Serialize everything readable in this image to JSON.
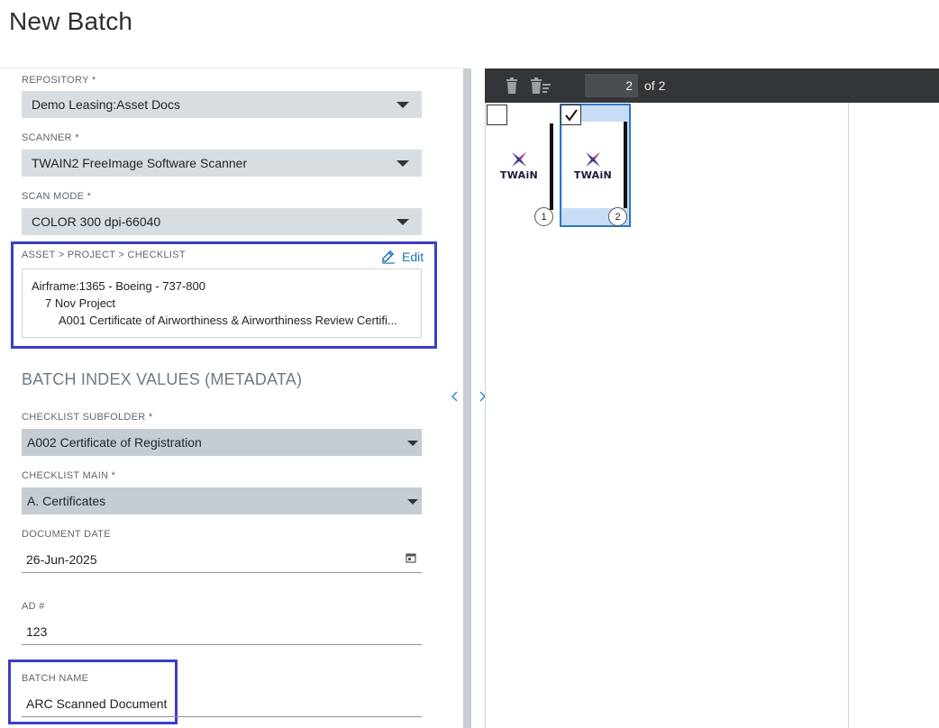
{
  "page": {
    "title": "New Batch"
  },
  "form": {
    "repository": {
      "label": "REPOSITORY *",
      "value": "Demo Leasing:Asset Docs"
    },
    "scanner": {
      "label": "SCANNER *",
      "value": "TWAIN2 FreeImage Software Scanner"
    },
    "scan_mode": {
      "label": "SCAN MODE *",
      "value": "COLOR 300 dpi-66040"
    },
    "asset_path": {
      "label": "ASSET > PROJECT > CHECKLIST",
      "edit_label": "Edit",
      "lines": [
        "Airframe:1365 - Boeing - 737-800",
        "7 Nov Project",
        "A001 Certificate of Airworthiness & Airworthiness Review Certifi..."
      ]
    },
    "section_heading": "BATCH INDEX VALUES (METADATA)",
    "checklist_subfolder": {
      "label": "CHECKLIST SUBFOLDER *",
      "value": "A002 Certificate of Registration"
    },
    "checklist_main": {
      "label": "CHECKLIST MAIN *",
      "value": "A. Certificates"
    },
    "document_date": {
      "label": "DOCUMENT DATE",
      "value": "26-Jun-2025"
    },
    "ad_number": {
      "label": "AD #",
      "value": "123"
    },
    "batch_name": {
      "label": "BATCH NAME",
      "value": "ARC Scanned Document"
    }
  },
  "viewer": {
    "current_page": "2",
    "of_label": "of 2",
    "thumbnails": [
      {
        "number": "1",
        "checked": false,
        "logo_text": "TWAiN"
      },
      {
        "number": "2",
        "checked": true,
        "logo_text": "TWAiN"
      }
    ]
  },
  "icons": [
    "trash-icon",
    "delete-multiple-icon",
    "pencil-icon",
    "calendar-icon",
    "chevron-left-icon",
    "chevron-right-icon",
    "checkmark-icon"
  ],
  "colors": {
    "highlight": "#3b3ec9",
    "link": "#1874b8",
    "toolbar": "#333639",
    "selected_thumb": "#c8dcf5"
  }
}
